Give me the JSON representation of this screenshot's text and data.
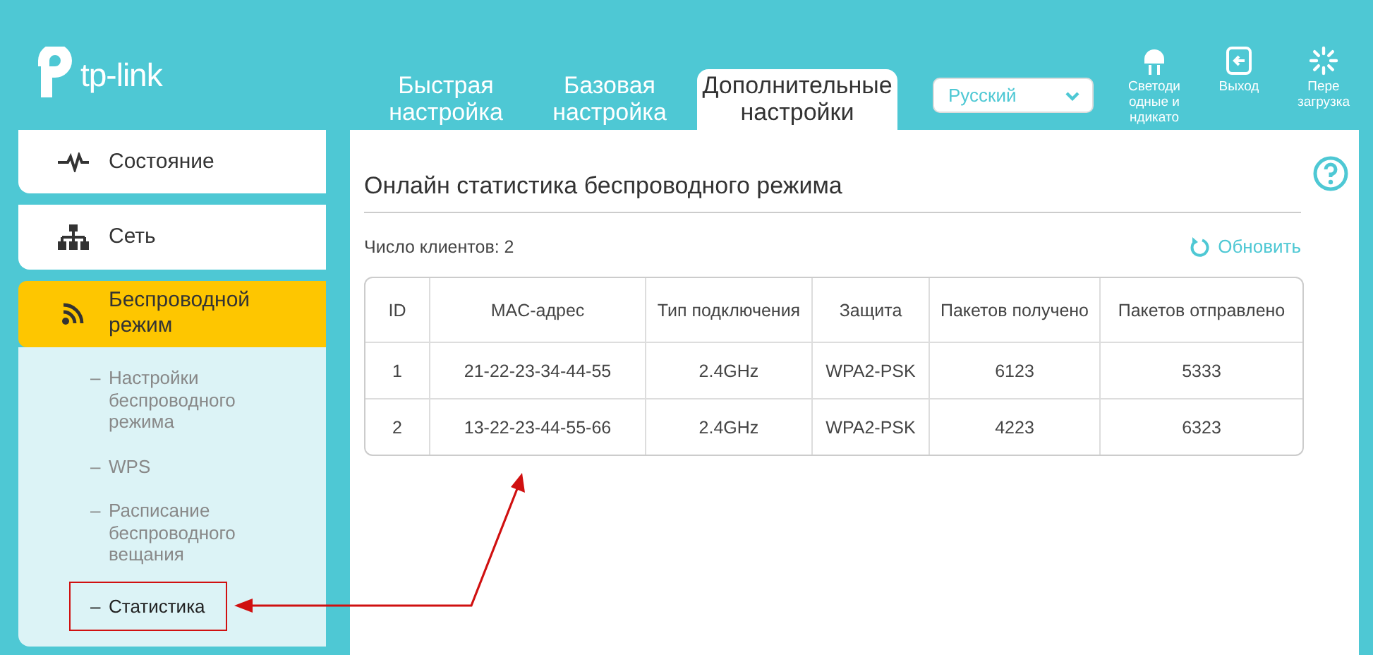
{
  "header": {
    "logo": "tp-link",
    "tabs": [
      {
        "label": "Быстрая настройка",
        "selected": false
      },
      {
        "label": "Базовая настройка",
        "selected": false
      },
      {
        "label": "Дополнительные настройки",
        "selected": true
      }
    ],
    "language": {
      "value": "Русский"
    },
    "actions": [
      {
        "kind": "led",
        "lines": [
          "Светоди",
          "одные и",
          "ндикато"
        ]
      },
      {
        "kind": "logout",
        "lines": [
          "Выход"
        ]
      },
      {
        "kind": "reboot",
        "lines": [
          "Пере",
          "загрузка"
        ]
      }
    ]
  },
  "sidebar": {
    "items": [
      {
        "kind": "status",
        "label": "Состояние",
        "selected": false
      },
      {
        "kind": "network",
        "label": "Сеть",
        "selected": false
      },
      {
        "kind": "wireless",
        "label": "Беспроводной режим",
        "selected": true,
        "children": [
          {
            "bullet": "–",
            "label": "Настройки беспроводного режима",
            "selected": false
          },
          {
            "bullet": "–",
            "label": "WPS",
            "selected": false
          },
          {
            "bullet": "–",
            "label": "Расписание беспроводного вещания",
            "selected": false
          },
          {
            "bullet": "–",
            "label": "Статистика",
            "selected": true
          }
        ]
      }
    ]
  },
  "content": {
    "title": "Онлайн статистика беспроводного режима",
    "clients": "Число клиентов: 2",
    "refresh": "Обновить",
    "table": {
      "columns": [
        "ID",
        "MAC-адрес",
        "Тип подключения",
        "Защита",
        "Пакетов получено",
        "Пакетов отправлено"
      ],
      "rows": [
        [
          "1",
          "21-22-23-34-44-55",
          "2.4GHz",
          "WPA2-PSK",
          "6123",
          "5333"
        ],
        [
          "2",
          "13-22-23-44-55-66",
          "2.4GHz",
          "WPA2-PSK",
          "4223",
          "6323"
        ]
      ]
    }
  }
}
